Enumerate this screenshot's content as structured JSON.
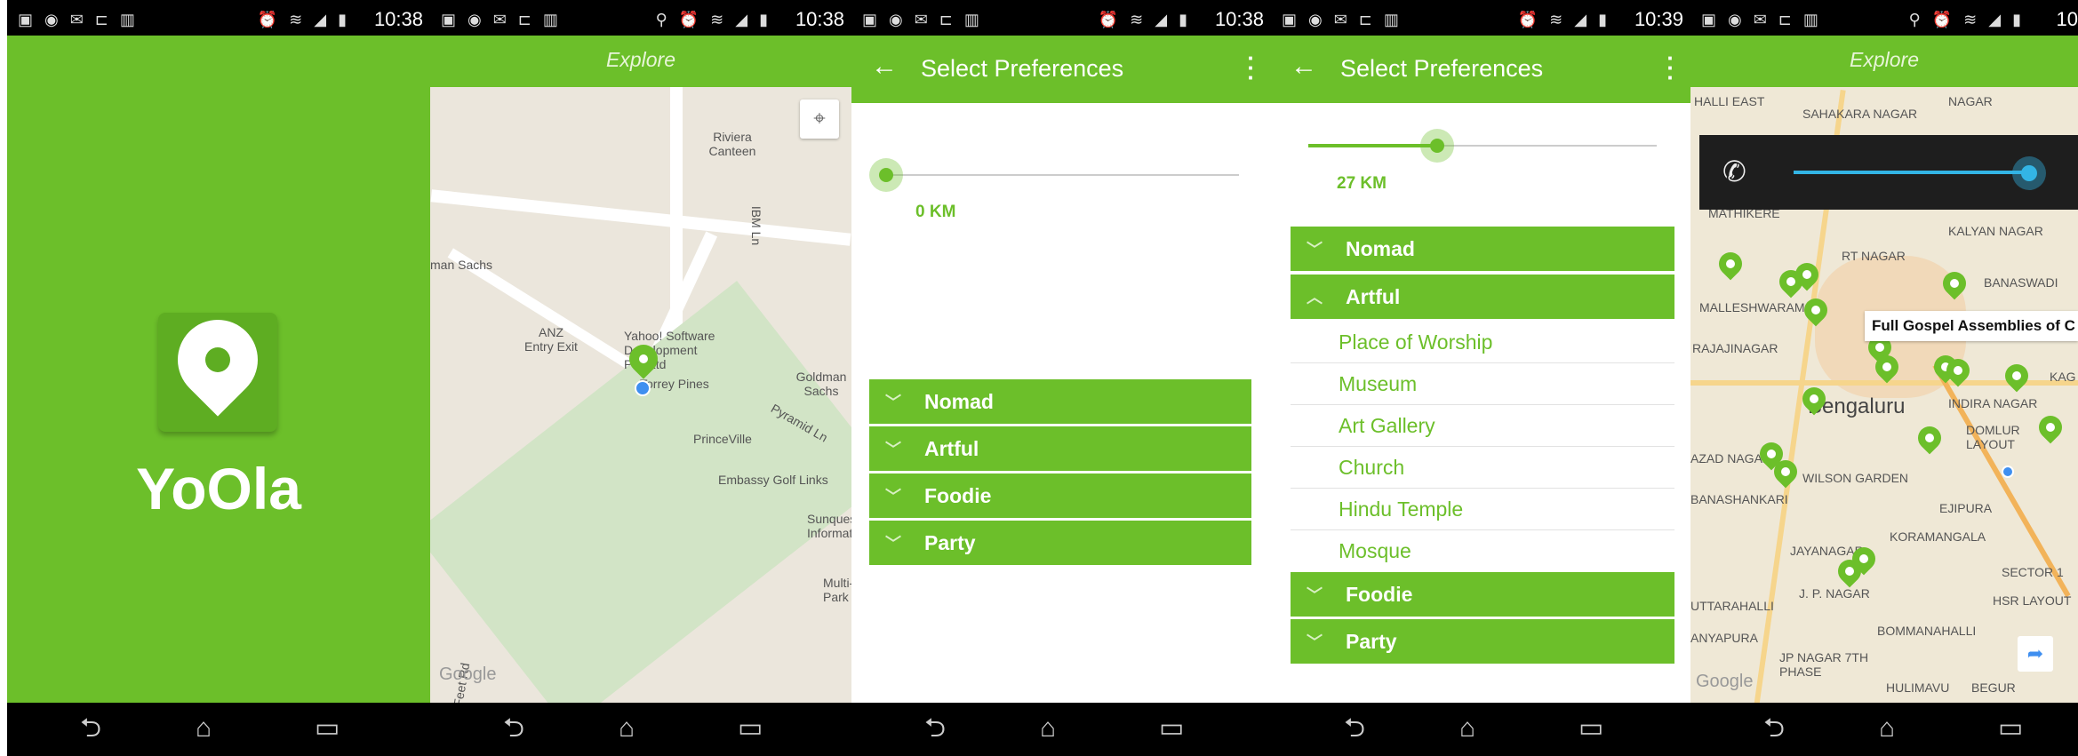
{
  "status_times": [
    "10:38",
    "10:38",
    "10:38",
    "10:39",
    "10"
  ],
  "splash": {
    "app_name": "YoOla"
  },
  "explore": {
    "title": "Explore",
    "map_labels": [
      "Riviera Canteen",
      "IBM Ln",
      "man Sachs",
      "ANZ Entry Exit",
      "Yahoo! Software Development Pvt. Ltd",
      "Torrey Pines",
      "Goldman Sachs",
      "Pyramid Ln",
      "PrinceVille",
      "Embassy Golf Links",
      "Sunques Informat",
      "Multi- Park",
      "Fifth Feet Rd",
      "Google"
    ]
  },
  "pref1": {
    "title": "Select Preferences",
    "distance": "0 KM",
    "categories": [
      "Nomad",
      "Artful",
      "Foodie",
      "Party"
    ]
  },
  "pref2": {
    "title": "Select Preferences",
    "distance": "27 KM",
    "categories_top": [
      "Nomad",
      "Artful"
    ],
    "artful_items": [
      "Place of Worship",
      "Museum",
      "Art Gallery",
      "Church",
      "Hindu Temple",
      "Mosque"
    ],
    "categories_bottom": [
      "Foodie",
      "Party"
    ]
  },
  "city": {
    "title": "Explore",
    "tooltip": "Full Gospel Assemblies of C",
    "map_labels": [
      "HALLI EAST",
      "SAHAKARA NAGAR",
      "NAGAR",
      "MATHIKERE",
      "KALYAN NAGAR",
      "RT NAGAR",
      "BANASWADI",
      "MALLESHWARAM",
      "RAJAJINAGAR",
      "Bengaluru",
      "INDIRA NAGAR",
      "DOMLUR LAYOUT",
      "AZAD NAGAR",
      "WILSON GARDEN",
      "BANASHANKARI",
      "EJIPURA",
      "KORAMANGALA",
      "JAYANAGAR",
      "SECTOR 1",
      "J. P. NAGAR",
      "HSR LAYOUT",
      "UTTARAHALLI",
      "BOMMANAHALLI",
      "ANYAPURA",
      "JP NAGAR 7TH PHASE",
      "HULIMAVU",
      "BEGUR",
      "Google",
      "KAG"
    ]
  },
  "colors": {
    "brand": "#6cbf2a",
    "volume": "#33b5e5"
  }
}
